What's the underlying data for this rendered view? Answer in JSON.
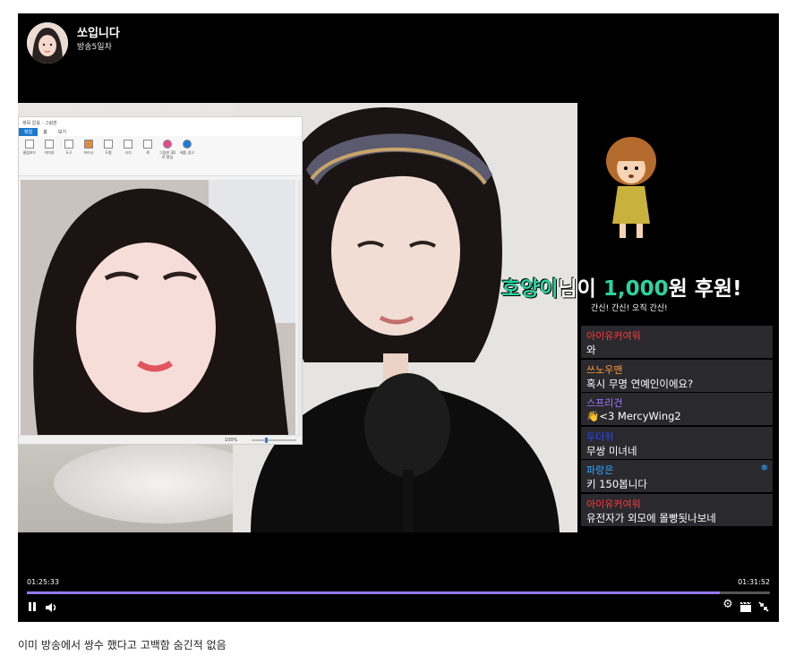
{
  "streamer": {
    "name": "쏘입니다",
    "broadcast_day": "방송5일차"
  },
  "paint": {
    "title": "제목 없음 - 그림판",
    "tabs": [
      "파일",
      "홈",
      "보기"
    ],
    "ribbon": [
      "클립보드",
      "이미지",
      "도구",
      "브러시",
      "도형",
      "크기",
      "색",
      "그림판 3D로 편집",
      "제품 경고"
    ],
    "zoom": "100%"
  },
  "donation": {
    "donor": "호양이",
    "suffix_honorific": "님이",
    "amount": "1,000",
    "suffix_amount": "원 후원!",
    "message": "간신! 간신! 오직 간신!"
  },
  "chat": [
    {
      "name": "아이유커여워",
      "message": "와",
      "color": "#ff3b3b"
    },
    {
      "name": "쓰노우맨",
      "message": "혹시 무명 연예인이에요?",
      "color": "#ff9a3b"
    },
    {
      "name": "스프리건",
      "message": "👋<3 MercyWing2",
      "color": "#a678ff"
    },
    {
      "name": "두더쥐",
      "message": "무쌍 미녀네",
      "color": "#2a4dff"
    },
    {
      "name": "파랑은",
      "message": "키 150봅니다",
      "color": "#36a7ff",
      "badge": "❄"
    },
    {
      "name": "아이유커여워",
      "message": "유전자가 외모에 몰빵됫나보네",
      "color": "#ff3b3b"
    }
  ],
  "player": {
    "time_current": "01:25:33",
    "time_total": "01:31:52",
    "progress": 0.932,
    "accent_color": "#9479ff"
  },
  "caption": "이미 방송에서 쌍수 했다고 고백함 숨긴적 없음"
}
